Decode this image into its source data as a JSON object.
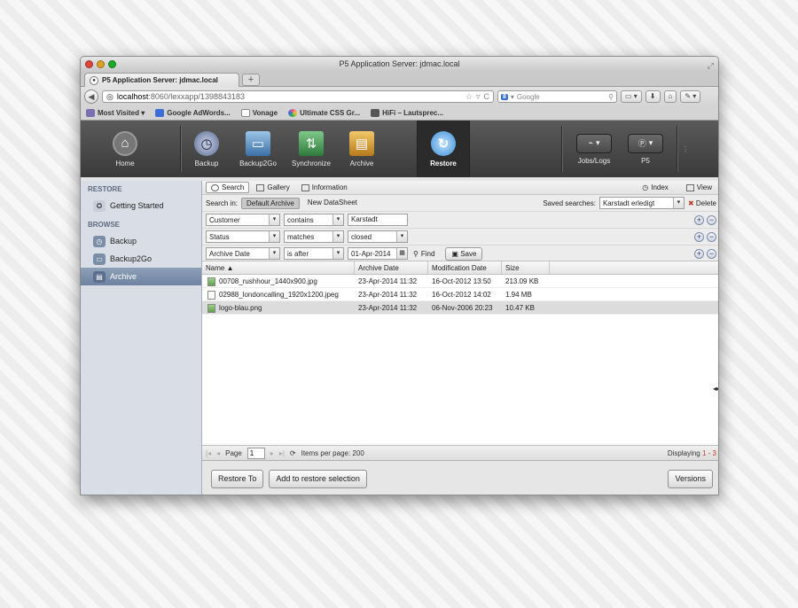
{
  "window": {
    "title": "P5 Application Server: jdmac.local"
  },
  "tab": {
    "title": "P5 Application Server: jdmac.local",
    "new_tab_label": "+"
  },
  "nav": {
    "url_host": "localhost",
    "url_rest": ":8060/lexxapp/1398843183",
    "search_placeholder": "Google",
    "search_engine": "8"
  },
  "bookmarks": [
    {
      "label": "Most Visited ▾",
      "icon": "most-visited-icon",
      "color": "#7b6fb0"
    },
    {
      "label": "Google AdWords...",
      "icon": "google-icon",
      "color": "#3b6fd6"
    },
    {
      "label": "Vonage",
      "icon": "page-icon",
      "color": "#dddddd"
    },
    {
      "label": "Ultimate CSS Gr...",
      "icon": "css-icon",
      "color": "#e05a9a"
    },
    {
      "label": "HiFi – Lautsprec...",
      "icon": "hifi-icon",
      "color": "#555555"
    }
  ],
  "toolbar": {
    "home": "Home",
    "backup": "Backup",
    "backup2go": "Backup2Go",
    "synchronize": "Synchronize",
    "archive": "Archive",
    "restore": "Restore",
    "jobs_logs": "Jobs/Logs",
    "p5": "P5"
  },
  "sidebar": {
    "restore_head": "RESTORE",
    "getting_started": "Getting Started",
    "browse_head": "BROWSE",
    "backup": "Backup",
    "backup2go": "Backup2Go",
    "archive": "Archive"
  },
  "viewtabs": {
    "search": "Search",
    "gallery": "Gallery",
    "information": "Information",
    "index": "Index",
    "view": "View"
  },
  "searchin": {
    "label": "Search in:",
    "default_archive": "Default Archive",
    "new_datasheet": "New DataSheet",
    "saved_label": "Saved searches:",
    "saved_value": "Karstadt erledigt",
    "delete": "Delete"
  },
  "criteria": [
    {
      "field": "Customer",
      "op": "contains",
      "value": "Karstadt"
    },
    {
      "field": "Status",
      "op": "matches",
      "value": "closed"
    },
    {
      "field": "Archive Date",
      "op": "is after",
      "value": "01-Apr-2014"
    }
  ],
  "actions": {
    "find": "Find",
    "save": "Save"
  },
  "grid": {
    "headers": [
      "Name ▲",
      "Archive Date",
      "Modification Date",
      "Size"
    ],
    "rows": [
      {
        "name": "00708_rushhour_1440x900.jpg",
        "archive": "23-Apr-2014 11:32",
        "modified": "16-Oct-2012 13:50",
        "size": "213.09 KB"
      },
      {
        "name": "02988_londoncalling_1920x1200.jpeg",
        "archive": "23-Apr-2014 11:32",
        "modified": "16-Oct-2012 14:02",
        "size": "1.94 MB"
      },
      {
        "name": "logo-blau.png",
        "archive": "23-Apr-2014 11:32",
        "modified": "06-Nov-2006 20:23",
        "size": "10.47 KB"
      }
    ]
  },
  "pager": {
    "page_label": "Page",
    "page_value": "1",
    "items_per_page": "Items per page: 200",
    "displaying_prefix": "Displaying ",
    "displaying_range": "1 - 3"
  },
  "bottom": {
    "restore_to": "Restore To",
    "add_to_selection": "Add to restore selection",
    "versions": "Versions"
  }
}
